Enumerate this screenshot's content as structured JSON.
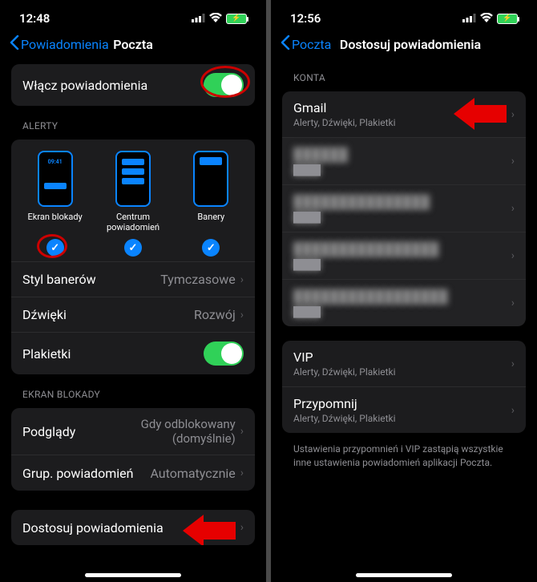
{
  "left": {
    "status_time": "12:48",
    "nav_back": "Powiadomienia",
    "nav_title": "Poczta",
    "enable_row": "Włącz powiadomienia",
    "alerts_header": "ALERTY",
    "alert_opts": {
      "lock": "Ekran blokady",
      "center": "Centrum powiadomień",
      "banner": "Banery",
      "lock_time": "09:41"
    },
    "banner_style_label": "Styl banerów",
    "banner_style_value": "Tymczasowe",
    "sounds_label": "Dźwięki",
    "sounds_value": "Rozwój",
    "badges_label": "Plakietki",
    "lock_header": "EKRAN BLOKADY",
    "previews_label": "Podglądy",
    "previews_value": "Gdy odblokowany (domyślnie)",
    "grouping_label": "Grup. powiadomień",
    "grouping_value": "Automatycznie",
    "customize_label": "Dostosuj powiadomienia"
  },
  "right": {
    "status_time": "12:56",
    "nav_back": "Poczta",
    "nav_title": "Dostosuj powiadomienia",
    "accounts_header": "KONTA",
    "gmail_title": "Gmail",
    "gmail_sub": "Alerty, Dźwięki, Plakietki",
    "vip_title": "VIP",
    "vip_sub": "Alerty, Dźwięki, Plakietki",
    "remind_title": "Przypomnij",
    "remind_sub": "Alerty, Dźwięki, Plakietki",
    "footer": "Ustawienia przypomnień i VIP zastąpią wszystkie inne ustawienia powiadomień aplikacji Poczta."
  }
}
